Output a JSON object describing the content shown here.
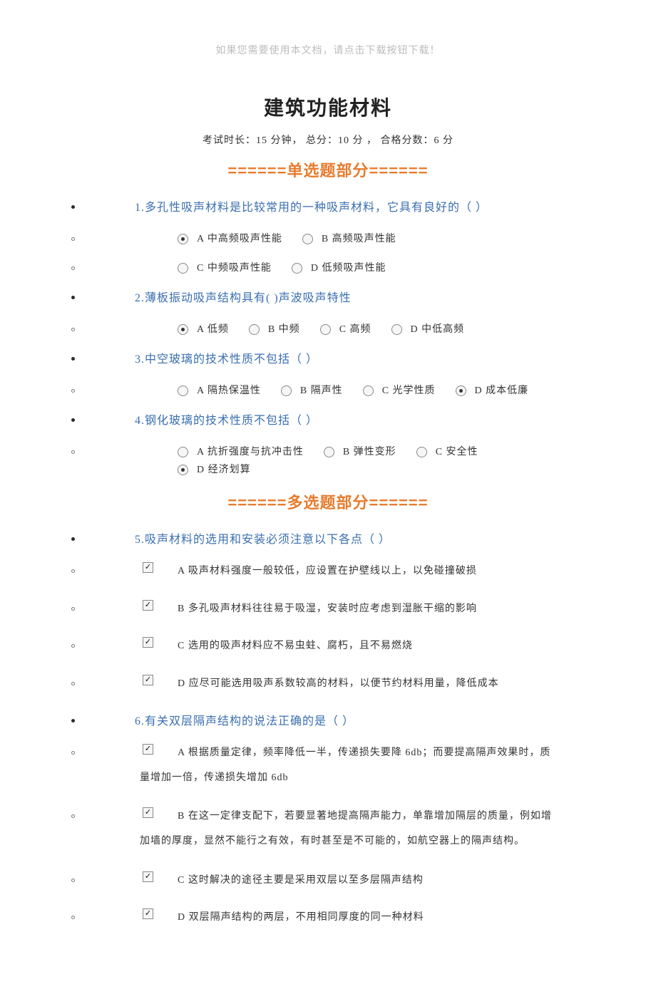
{
  "top_note": "如果您需要使用本文档，请点击下载按钮下载！",
  "title": "建筑功能材料",
  "subtitle": "考试时长：15 分钟，  总分：10 分 ， 合格分数：6 分",
  "section_single": "======单选题部分======",
  "section_multi": "======多选题部分======",
  "q1": {
    "text": "1.多孔性吸声材料是比较常用的一种吸声材料，它具有良好的（ ）",
    "row1": [
      {
        "label": "A 中高频吸声性能",
        "selected": true
      },
      {
        "label": "B 高频吸声性能",
        "selected": false
      }
    ],
    "row2": [
      {
        "label": "C 中频吸声性能",
        "selected": false
      },
      {
        "label": "D 低频吸声性能",
        "selected": false
      }
    ]
  },
  "q2": {
    "text": "2.薄板振动吸声结构具有( )声波吸声特性",
    "opts": [
      {
        "label": "A 低频",
        "selected": true
      },
      {
        "label": "B 中频",
        "selected": false
      },
      {
        "label": "C 高频",
        "selected": false
      },
      {
        "label": "D 中低高频",
        "selected": false
      }
    ]
  },
  "q3": {
    "text": "3.中空玻璃的技术性质不包括（ ）",
    "opts": [
      {
        "label": "A 隔热保温性",
        "selected": false
      },
      {
        "label": "B 隔声性",
        "selected": false
      },
      {
        "label": "C 光学性质",
        "selected": false
      },
      {
        "label": "D 成本低廉",
        "selected": true
      }
    ]
  },
  "q4": {
    "text": "4.钢化玻璃的技术性质不包括（ ）",
    "opts": [
      {
        "label": "A 抗折强度与抗冲击性",
        "selected": false
      },
      {
        "label": "B 弹性变形",
        "selected": false
      },
      {
        "label": "C 安全性",
        "selected": false
      },
      {
        "label": "D 经济划算",
        "selected": true
      }
    ]
  },
  "q5": {
    "text": "5.吸声材料的选用和安装必须注意以下各点（ ）",
    "opts": [
      {
        "label": "A 吸声材料强度一般较低，应设置在护壁线以上，以免碰撞破损",
        "checked": true
      },
      {
        "label": "B 多孔吸声材料往往易于吸湿，安装时应考虑到湿胀干缩的影响",
        "checked": true
      },
      {
        "label": "C 选用的吸声材料应不易虫蛀、腐朽，且不易燃烧",
        "checked": true
      },
      {
        "label": "D 应尽可能选用吸声系数较高的材料，以便节约材料用量，降低成本",
        "checked": true
      }
    ]
  },
  "q6": {
    "text": "6.有关双层隔声结构的说法正确的是（ ）",
    "opts": [
      {
        "label": "A 根据质量定律，频率降低一半，传递损失要降 6db；而要提高隔声效果时，质",
        "cont": "量增加一倍，传递损失增加 6db",
        "checked": true
      },
      {
        "label": "B 在这一定律支配下，若要显著地提高隔声能力，单靠增加隔层的质量，例如增",
        "cont": "加墙的厚度，显然不能行之有效，有时甚至是不可能的，如航空器上的隔声结构。",
        "checked": true
      },
      {
        "label": "C 这时解决的途径主要是采用双层以至多层隔声结构",
        "checked": true
      },
      {
        "label": "D 双层隔声结构的两层，不用相同厚度的同一种材料",
        "checked": true
      }
    ]
  }
}
